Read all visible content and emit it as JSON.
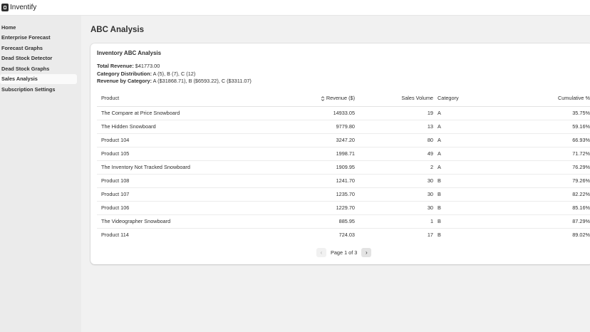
{
  "app": {
    "title": "Inventify",
    "logo_icon": "app-logo-icon"
  },
  "sidebar": {
    "items": [
      {
        "label": "Home",
        "active": false
      },
      {
        "label": "Enterprise Forecast",
        "active": false
      },
      {
        "label": "Forecast Graphs",
        "active": false
      },
      {
        "label": "Dead Stock Detector",
        "active": false
      },
      {
        "label": "Dead Stock Graphs",
        "active": false
      },
      {
        "label": "Sales Analysis",
        "active": true
      },
      {
        "label": "Subscription Settings",
        "active": false
      }
    ]
  },
  "page": {
    "title": "ABC Analysis"
  },
  "card": {
    "title": "Inventory ABC Analysis",
    "summary": {
      "total_revenue_label": "Total Revenue:",
      "total_revenue_value": " $41773.00",
      "category_distribution_label": "Category Distribution:",
      "category_distribution_value": " A (5), B (7), C (12)",
      "revenue_by_category_label": "Revenue by Category:",
      "revenue_by_category_value": " A ($31868.71), B ($6593.22), C ($3311.07)"
    },
    "table": {
      "headers": {
        "product": "Product",
        "revenue": "Revenue ($)",
        "sales_volume": "Sales Volume",
        "category": "Category",
        "cumulative": "Cumulative %"
      },
      "sorted_column": "revenue",
      "rows": [
        {
          "product": "The Compare at Price Snowboard",
          "revenue": "14933.05",
          "sales_volume": "19",
          "category": "A",
          "cumulative": "35.75%"
        },
        {
          "product": "The Hidden Snowboard",
          "revenue": "9779.80",
          "sales_volume": "13",
          "category": "A",
          "cumulative": "59.16%"
        },
        {
          "product": "Product 104",
          "revenue": "3247.20",
          "sales_volume": "80",
          "category": "A",
          "cumulative": "66.93%"
        },
        {
          "product": "Product 105",
          "revenue": "1998.71",
          "sales_volume": "49",
          "category": "A",
          "cumulative": "71.72%"
        },
        {
          "product": "The Inventory Not Tracked Snowboard",
          "revenue": "1909.95",
          "sales_volume": "2",
          "category": "A",
          "cumulative": "76.29%"
        },
        {
          "product": "Product 108",
          "revenue": "1241.70",
          "sales_volume": "30",
          "category": "B",
          "cumulative": "79.26%"
        },
        {
          "product": "Product 107",
          "revenue": "1235.70",
          "sales_volume": "30",
          "category": "B",
          "cumulative": "82.22%"
        },
        {
          "product": "Product 106",
          "revenue": "1229.70",
          "sales_volume": "30",
          "category": "B",
          "cumulative": "85.16%"
        },
        {
          "product": "The Videographer Snowboard",
          "revenue": "885.95",
          "sales_volume": "1",
          "category": "B",
          "cumulative": "87.29%"
        },
        {
          "product": "Product 114",
          "revenue": "724.03",
          "sales_volume": "17",
          "category": "B",
          "cumulative": "89.02%"
        }
      ]
    },
    "pagination": {
      "label": "Page 1 of 3",
      "prev_icon": "chevron-left-icon",
      "next_icon": "chevron-right-icon",
      "prev_disabled": true
    }
  }
}
